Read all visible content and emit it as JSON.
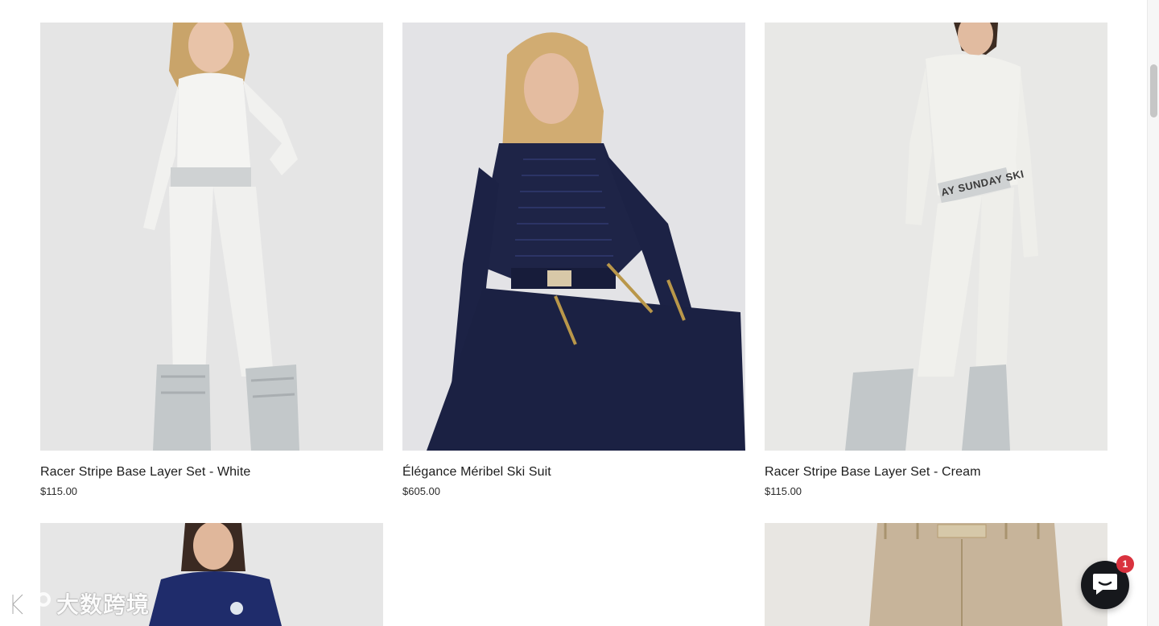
{
  "products": [
    {
      "title": "Racer Stripe Base Layer Set - White",
      "price": "$115.00",
      "image": "model-white-base-layer-moon-boots"
    },
    {
      "title": "Élégance Méribel Ski Suit",
      "price": "$605.00",
      "image": "model-navy-quilted-ski-suit"
    },
    {
      "title": "Racer Stripe Base Layer Set - Cream",
      "price": "$115.00",
      "image": "model-cream-base-layer-moon-boots"
    }
  ],
  "products_row2": [
    {
      "image": "model-navy-top"
    },
    {
      "image": "beige-ski-pants"
    }
  ],
  "waistband_text": "AY SUNDAY SKI",
  "chat": {
    "badge_count": "1",
    "icon": "chat-bubble-icon"
  },
  "watermark": {
    "text": "大数跨境"
  },
  "colors": {
    "navy": "#1d2346",
    "cream": "#ecebe6",
    "background_grey": "#e6e6e6",
    "chat_bg": "#16181c",
    "badge_red": "#d9323e"
  }
}
